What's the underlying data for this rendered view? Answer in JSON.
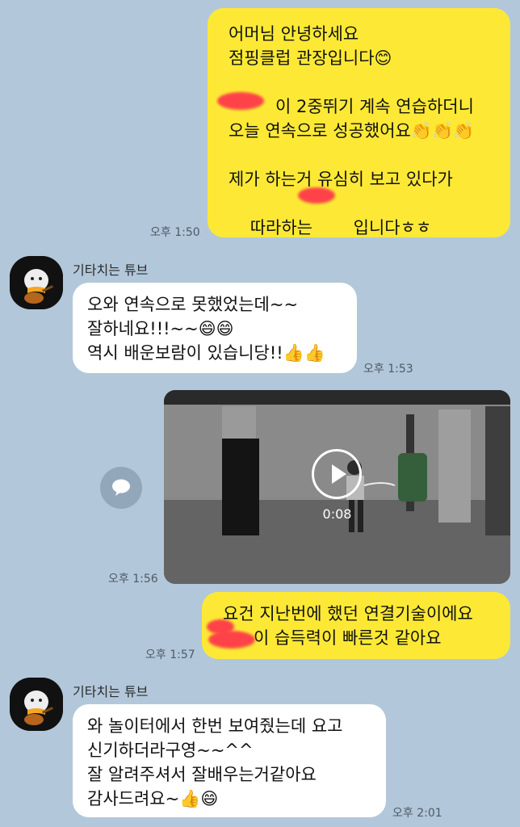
{
  "messages": [
    {
      "type": "outgoing",
      "lines": [
        "어머님 안녕하세요",
        "점핑클럽 관장입니다😊",
        "",
        "이 2중뛰기 계속 연습하더니",
        "오늘 연속으로 성공했어요👏👏👏",
        "",
        "제가 하는거 유심히 보고 있다가",
        "따라하는 입니다ㅎㅎ"
      ],
      "time": "오후 1:50"
    },
    {
      "type": "incoming",
      "sender": "기타치는 튜브",
      "lines": [
        "오와 연속으로 못했었는데~~",
        "잘하네요!!!~~😄😄",
        "역시 배운보람이 있습니당!!👍👍"
      ],
      "time": "오후 1:53"
    },
    {
      "type": "video",
      "duration": "0:08",
      "time": "오후 1:56"
    },
    {
      "type": "outgoing",
      "lines": [
        "요건 지난번에 했던 연결기술이에요",
        "이 습득력이 빠른것 같아요"
      ],
      "time": "오후 1:57"
    },
    {
      "type": "incoming",
      "sender": "기타치는 튜브",
      "lines": [
        "와 놀이터에서 한번 보여줬는데 요고",
        "신기하더라구영~~^^",
        "잘 알려주셔서 잘배우는거같아요",
        "감사드려요~👍😄"
      ],
      "time": "오후 2:01"
    }
  ],
  "icons": {
    "share": "share-bubble-icon",
    "play": "play-icon",
    "avatar": "tube-avatar"
  },
  "colors": {
    "background": "#b2c7da",
    "outgoing_bubble": "#fde935",
    "incoming_bubble": "#ffffff"
  }
}
